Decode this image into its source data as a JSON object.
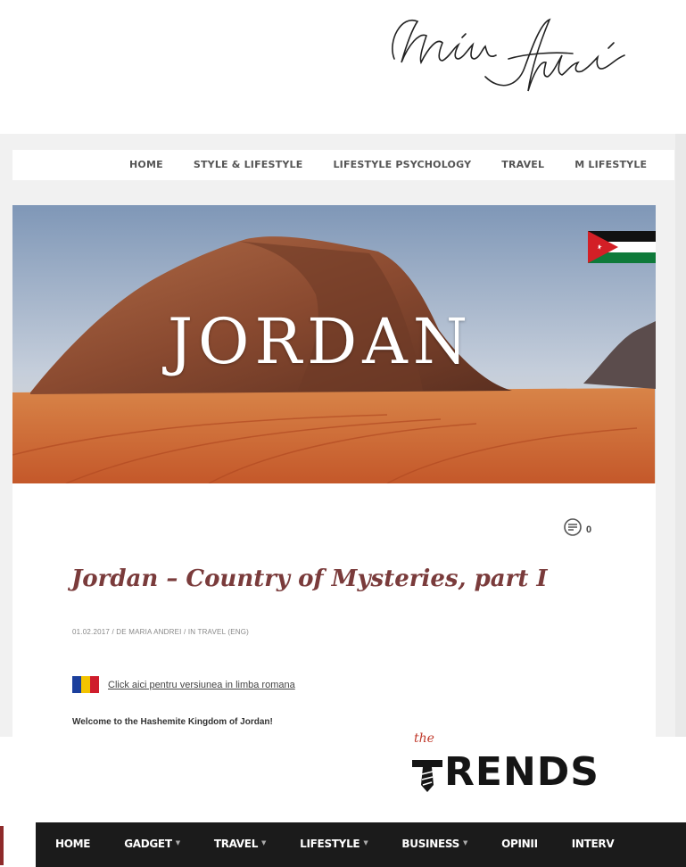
{
  "signature": {
    "text": "María Andrei"
  },
  "main_nav": {
    "items": [
      "HOME",
      "STYLE & LIFESTYLE",
      "LIFESTYLE PSYCHOLOGY",
      "TRAVEL",
      "M LIFESTYLE"
    ]
  },
  "hero": {
    "title": "JORDAN",
    "flag": "jordan-flag"
  },
  "post": {
    "comment_count": "0",
    "title": "Jordan – Country of Mysteries, part I",
    "meta": "01.02.2017 / DE MARIA ANDREI / IN TRAVEL (ENG)",
    "lang_link": "Click aici pentru versiunea in limba romana",
    "welcome": "Welcome to the Hashemite Kingdom of Jordan!"
  },
  "trends": {
    "logo_small": "the",
    "logo_word": "RENDS",
    "nav": [
      {
        "label": "HOME",
        "dropdown": false
      },
      {
        "label": "GADGET",
        "dropdown": true
      },
      {
        "label": "TRAVEL",
        "dropdown": true
      },
      {
        "label": "LIFESTYLE",
        "dropdown": true
      },
      {
        "label": "BUSINESS",
        "dropdown": true
      },
      {
        "label": "OPINII",
        "dropdown": false
      },
      {
        "label": "INTERV",
        "dropdown": false
      }
    ]
  },
  "colors": {
    "title": "#7a3b3b",
    "dark_nav": "#1b1b1b",
    "accent_red": "#c0392b"
  }
}
